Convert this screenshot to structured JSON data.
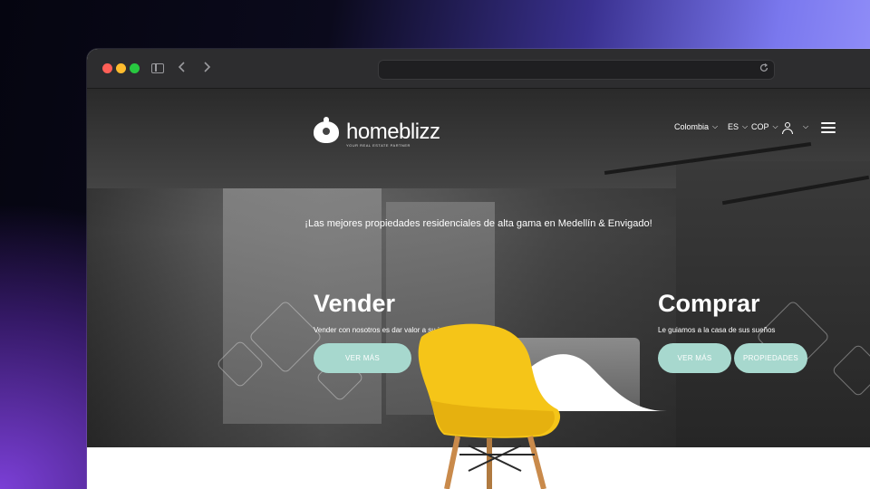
{
  "browser": {
    "url": "",
    "controls": {
      "back_icon": "chevron-left-icon",
      "forward_icon": "chevron-right-icon",
      "reload_icon": "reload-icon"
    }
  },
  "site": {
    "logo_text": "homeblizz",
    "logo_sub": "YOUR REAL ESTATE PARTNER",
    "nav": {
      "country": "Colombia",
      "language": "ES",
      "currency": "COP"
    },
    "tagline": "¡Las mejores propiedades residenciales de alta gama en Medellín & Envigado!",
    "sell": {
      "title": "Vender",
      "subtitle": "Vender con nosotros es dar valor a su inmueble",
      "button": "VER MÁS"
    },
    "buy": {
      "title": "Comprar",
      "subtitle": "Le guiamos a la casa de sus sueños",
      "button_more": "VER MÁS",
      "button_properties": "PROPIEDADES"
    }
  },
  "colors": {
    "accent_button": "#a7d8ce",
    "chair": "#f5c518",
    "browser_chrome": "#2d2d2f"
  }
}
